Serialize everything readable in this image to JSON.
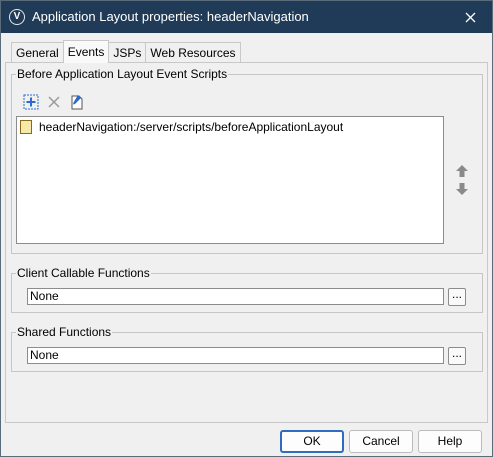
{
  "window": {
    "title": "Application Layout properties: headerNavigation",
    "app_icon_letter": "V"
  },
  "tabs": [
    {
      "label": "General",
      "active": false
    },
    {
      "label": "Events",
      "active": true
    },
    {
      "label": "JSPs",
      "active": false
    },
    {
      "label": "Web Resources",
      "active": false
    }
  ],
  "before_scripts": {
    "title": "Before Application Layout Event Scripts",
    "toolbar": {
      "add_icon": "add-icon",
      "remove_icon": "remove-x-icon",
      "edit_icon": "edit-script-icon"
    },
    "items": [
      {
        "label": "headerNavigation:/server/scripts/beforeApplicationLayout",
        "icon": "script-file-icon"
      }
    ]
  },
  "client_callable": {
    "title": "Client Callable Functions",
    "value": "None",
    "browse_label": "..."
  },
  "shared_functions": {
    "title": "Shared Functions",
    "value": "None",
    "browse_label": "..."
  },
  "buttons": {
    "ok": "OK",
    "cancel": "Cancel",
    "help": "Help"
  },
  "colors": {
    "titlebar": "#1f3b58",
    "default_button_border": "#2f6bbf",
    "add_icon": "#2a6bd1"
  }
}
